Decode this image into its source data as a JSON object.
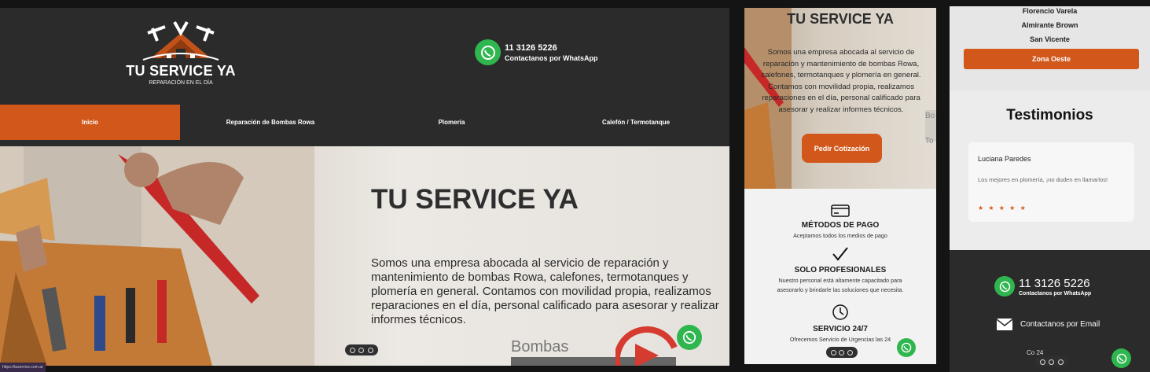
{
  "desktop": {
    "logo": {
      "title": "TU SERVICE YA",
      "subtitle": "REPARACIÓN EN EL DÍA"
    },
    "whatsapp": {
      "number": "11 3126 5226",
      "label": "Contactanos por WhatsApp"
    },
    "nav": [
      {
        "label": "Inicio",
        "active": true
      },
      {
        "label": "Reparación de Bombas Rowa",
        "active": false
      },
      {
        "label": "Plomeria",
        "active": false
      },
      {
        "label": "Calefón / Termotanque",
        "active": false
      }
    ],
    "hero": {
      "title": "TU SERVICE YA",
      "text": "Somos una empresa abocada al servicio de reparación y mantenimiento de bombas Rowa, calefones, termotanques y plomería en general. Contamos con movilidad propia, realizamos reparaciones en el día, personal calificado para asesorar y realizar informes técnicos.",
      "brand": "Bombas"
    },
    "status_url": "https://tuservice.com.ar"
  },
  "mobile": {
    "hero": {
      "title": "TU SERVICE YA",
      "text": "Somos una empresa abocada al servicio de reparación y mantenimiento de bombas Rowa, calefones, termotanques y plomería en general. Contamos con movilidad propia, realizamos reparaciones en el día, personal calificado para asesorar y realizar informes técnicos.",
      "cta": "Pedir Cotización",
      "side_text_1": "Bo",
      "side_text_2": "To"
    },
    "features": [
      {
        "title": "MÉTODOS DE PAGO",
        "text": "Aceptamos todos los medios de pago"
      },
      {
        "title": "SOLO PROFESIONALES",
        "text": "Nuestro personal está altamente capacitado para asesorarlo y brindarle las soluciones que necesita."
      },
      {
        "title": "SERVICIO 24/7",
        "text": "Ofrecemos Servicio de Urgencias las 24"
      }
    ]
  },
  "mobile2": {
    "zones": [
      "Florencio Varela",
      "Almirante Brown",
      "San Vicente"
    ],
    "zone_button": "Zona Oeste",
    "testimonials_title": "Testimonios",
    "testimonial": {
      "name": "Luciana Paredes",
      "text": "Los mejores en plomería, ¡no duden en llamarlos!",
      "stars": "★ ★ ★ ★ ★"
    },
    "footer": {
      "whatsapp_number": "11 3126 5226",
      "whatsapp_label": "Contactanos por WhatsApp",
      "email_label": "Contactanos por Email",
      "last_line": "Co                24"
    }
  },
  "colors": {
    "accent": "#d2571a",
    "dark": "#2b2b2b",
    "whatsapp": "#2fb64f"
  }
}
